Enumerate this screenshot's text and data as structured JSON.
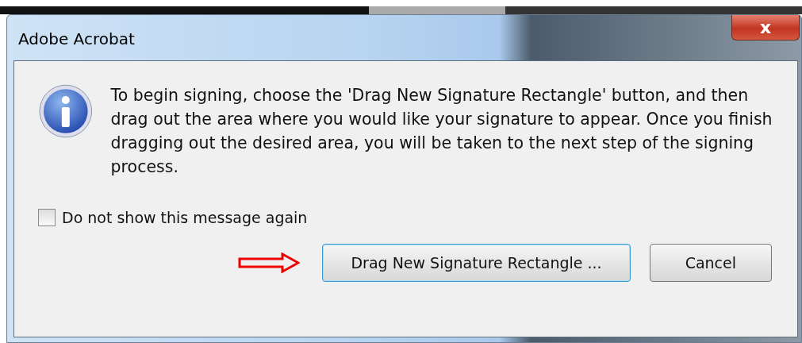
{
  "window": {
    "title": "Adobe Acrobat",
    "close": "x"
  },
  "message": "To begin signing, choose the 'Drag New Signature Rectangle' button, and then drag out the area where you would like your signature to appear. Once you finish dragging out the desired area, you will be taken to the next step of the signing process.",
  "checkbox": {
    "label": "Do not show this message again",
    "checked": false
  },
  "buttons": [
    {
      "label": "Drag New Signature Rectangle ...",
      "default": true,
      "pointed": true
    },
    {
      "label": "Cancel",
      "default": false,
      "pointed": false
    }
  ]
}
